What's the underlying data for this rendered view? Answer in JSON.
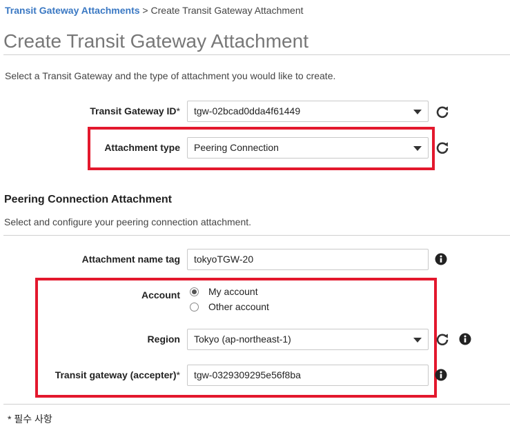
{
  "breadcrumb": {
    "parent": "Transit Gateway Attachments",
    "separator": " > ",
    "current": "Create Transit Gateway Attachment"
  },
  "page_title": "Create Transit Gateway Attachment",
  "intro": "Select a Transit Gateway and the type of attachment you would like to create.",
  "form": {
    "tgw_id": {
      "label": "Transit Gateway ID",
      "required_mark": "*",
      "value": "tgw-02bcad0dda4f61449"
    },
    "attachment_type": {
      "label": "Attachment type",
      "value": "Peering Connection"
    }
  },
  "peering": {
    "title": "Peering Connection Attachment",
    "description": "Select and configure your peering connection attachment.",
    "name_tag": {
      "label": "Attachment name tag",
      "value": "tokyoTGW-20"
    },
    "account": {
      "label": "Account",
      "options": [
        "My account",
        "Other account"
      ],
      "selected": "My account"
    },
    "region": {
      "label": "Region",
      "value": "Tokyo (ap-northeast-1)"
    },
    "accepter": {
      "label": "Transit gateway (accepter)",
      "required_mark": "*",
      "value": "tgw-0329309295e56f8ba"
    }
  },
  "footnote": "* 필수 사항",
  "colors": {
    "highlight": "#e3182d",
    "link": "#3a78c3",
    "title": "#777777"
  },
  "icons": [
    "refresh-icon",
    "info-icon",
    "dropdown-caret-icon"
  ]
}
